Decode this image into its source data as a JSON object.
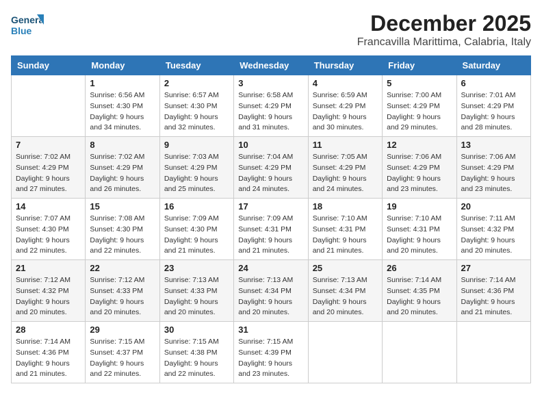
{
  "logo": {
    "line1": "General",
    "line2": "Blue"
  },
  "title": {
    "month_year": "December 2025",
    "location": "Francavilla Marittima, Calabria, Italy"
  },
  "days_of_week": [
    "Sunday",
    "Monday",
    "Tuesday",
    "Wednesday",
    "Thursday",
    "Friday",
    "Saturday"
  ],
  "weeks": [
    [
      {
        "day": "",
        "info": ""
      },
      {
        "day": "1",
        "info": "Sunrise: 6:56 AM\nSunset: 4:30 PM\nDaylight: 9 hours\nand 34 minutes."
      },
      {
        "day": "2",
        "info": "Sunrise: 6:57 AM\nSunset: 4:30 PM\nDaylight: 9 hours\nand 32 minutes."
      },
      {
        "day": "3",
        "info": "Sunrise: 6:58 AM\nSunset: 4:29 PM\nDaylight: 9 hours\nand 31 minutes."
      },
      {
        "day": "4",
        "info": "Sunrise: 6:59 AM\nSunset: 4:29 PM\nDaylight: 9 hours\nand 30 minutes."
      },
      {
        "day": "5",
        "info": "Sunrise: 7:00 AM\nSunset: 4:29 PM\nDaylight: 9 hours\nand 29 minutes."
      },
      {
        "day": "6",
        "info": "Sunrise: 7:01 AM\nSunset: 4:29 PM\nDaylight: 9 hours\nand 28 minutes."
      }
    ],
    [
      {
        "day": "7",
        "info": "Sunrise: 7:02 AM\nSunset: 4:29 PM\nDaylight: 9 hours\nand 27 minutes."
      },
      {
        "day": "8",
        "info": "Sunrise: 7:02 AM\nSunset: 4:29 PM\nDaylight: 9 hours\nand 26 minutes."
      },
      {
        "day": "9",
        "info": "Sunrise: 7:03 AM\nSunset: 4:29 PM\nDaylight: 9 hours\nand 25 minutes."
      },
      {
        "day": "10",
        "info": "Sunrise: 7:04 AM\nSunset: 4:29 PM\nDaylight: 9 hours\nand 24 minutes."
      },
      {
        "day": "11",
        "info": "Sunrise: 7:05 AM\nSunset: 4:29 PM\nDaylight: 9 hours\nand 24 minutes."
      },
      {
        "day": "12",
        "info": "Sunrise: 7:06 AM\nSunset: 4:29 PM\nDaylight: 9 hours\nand 23 minutes."
      },
      {
        "day": "13",
        "info": "Sunrise: 7:06 AM\nSunset: 4:29 PM\nDaylight: 9 hours\nand 23 minutes."
      }
    ],
    [
      {
        "day": "14",
        "info": "Sunrise: 7:07 AM\nSunset: 4:30 PM\nDaylight: 9 hours\nand 22 minutes."
      },
      {
        "day": "15",
        "info": "Sunrise: 7:08 AM\nSunset: 4:30 PM\nDaylight: 9 hours\nand 22 minutes."
      },
      {
        "day": "16",
        "info": "Sunrise: 7:09 AM\nSunset: 4:30 PM\nDaylight: 9 hours\nand 21 minutes."
      },
      {
        "day": "17",
        "info": "Sunrise: 7:09 AM\nSunset: 4:31 PM\nDaylight: 9 hours\nand 21 minutes."
      },
      {
        "day": "18",
        "info": "Sunrise: 7:10 AM\nSunset: 4:31 PM\nDaylight: 9 hours\nand 21 minutes."
      },
      {
        "day": "19",
        "info": "Sunrise: 7:10 AM\nSunset: 4:31 PM\nDaylight: 9 hours\nand 20 minutes."
      },
      {
        "day": "20",
        "info": "Sunrise: 7:11 AM\nSunset: 4:32 PM\nDaylight: 9 hours\nand 20 minutes."
      }
    ],
    [
      {
        "day": "21",
        "info": "Sunrise: 7:12 AM\nSunset: 4:32 PM\nDaylight: 9 hours\nand 20 minutes."
      },
      {
        "day": "22",
        "info": "Sunrise: 7:12 AM\nSunset: 4:33 PM\nDaylight: 9 hours\nand 20 minutes."
      },
      {
        "day": "23",
        "info": "Sunrise: 7:13 AM\nSunset: 4:33 PM\nDaylight: 9 hours\nand 20 minutes."
      },
      {
        "day": "24",
        "info": "Sunrise: 7:13 AM\nSunset: 4:34 PM\nDaylight: 9 hours\nand 20 minutes."
      },
      {
        "day": "25",
        "info": "Sunrise: 7:13 AM\nSunset: 4:34 PM\nDaylight: 9 hours\nand 20 minutes."
      },
      {
        "day": "26",
        "info": "Sunrise: 7:14 AM\nSunset: 4:35 PM\nDaylight: 9 hours\nand 20 minutes."
      },
      {
        "day": "27",
        "info": "Sunrise: 7:14 AM\nSunset: 4:36 PM\nDaylight: 9 hours\nand 21 minutes."
      }
    ],
    [
      {
        "day": "28",
        "info": "Sunrise: 7:14 AM\nSunset: 4:36 PM\nDaylight: 9 hours\nand 21 minutes."
      },
      {
        "day": "29",
        "info": "Sunrise: 7:15 AM\nSunset: 4:37 PM\nDaylight: 9 hours\nand 22 minutes."
      },
      {
        "day": "30",
        "info": "Sunrise: 7:15 AM\nSunset: 4:38 PM\nDaylight: 9 hours\nand 22 minutes."
      },
      {
        "day": "31",
        "info": "Sunrise: 7:15 AM\nSunset: 4:39 PM\nDaylight: 9 hours\nand 23 minutes."
      },
      {
        "day": "",
        "info": ""
      },
      {
        "day": "",
        "info": ""
      },
      {
        "day": "",
        "info": ""
      }
    ]
  ]
}
